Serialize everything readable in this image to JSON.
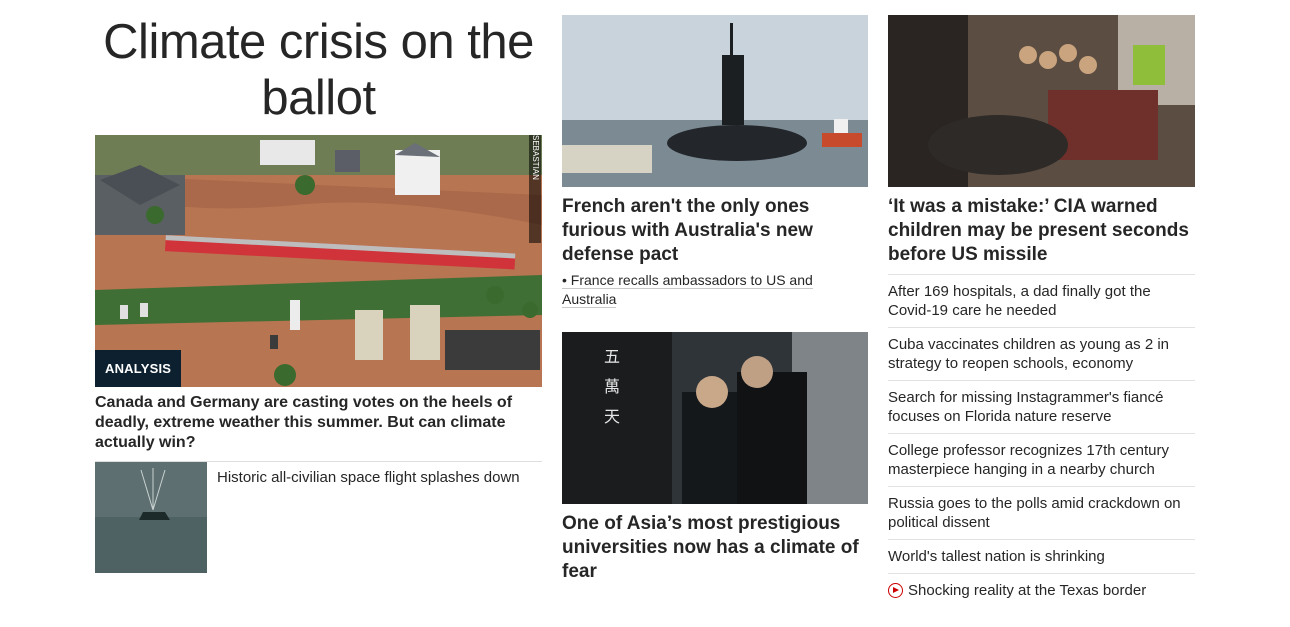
{
  "col1": {
    "headline": "Climate crisis on the ballot",
    "hero": {
      "tag": "ANALYSIS",
      "credit": "SEBASTIAN SCHMITT/DPA/AP",
      "caption": "Canada and Germany are casting votes on the heels of deadly, extreme weather this summer. But can climate actually win?"
    },
    "small_story": {
      "title": "Historic all-civilian space flight splashes down"
    }
  },
  "col2": {
    "story1": {
      "title": "French aren't the only ones furious with Australia's new defense pact",
      "bullet": "• France recalls ambassadors to US and Australia"
    },
    "story2": {
      "title": "One of Asia’s most prestigious universities now has a climate of fear"
    }
  },
  "col3": {
    "story1": {
      "title": "‘It was a mistake:’ CIA warned children may be present seconds before US missile"
    },
    "list": [
      "After 169 hospitals, a dad finally got the Covid-19 care he needed",
      "Cuba vaccinates children as young as 2 in strategy to reopen schools, economy",
      "Search for missing Instagrammer's fiancé focuses on Florida nature reserve",
      "College professor recognizes 17th century masterpiece hanging in a nearby church",
      "Russia goes to the polls amid crackdown on political dissent",
      "World's tallest nation is shrinking"
    ],
    "video_item": {
      "title": "Shocking reality at the Texas border",
      "icon": "play-icon"
    }
  },
  "colors": {
    "accent": "#cc0000",
    "tag_bg": "#0c2030",
    "text": "#262626"
  }
}
